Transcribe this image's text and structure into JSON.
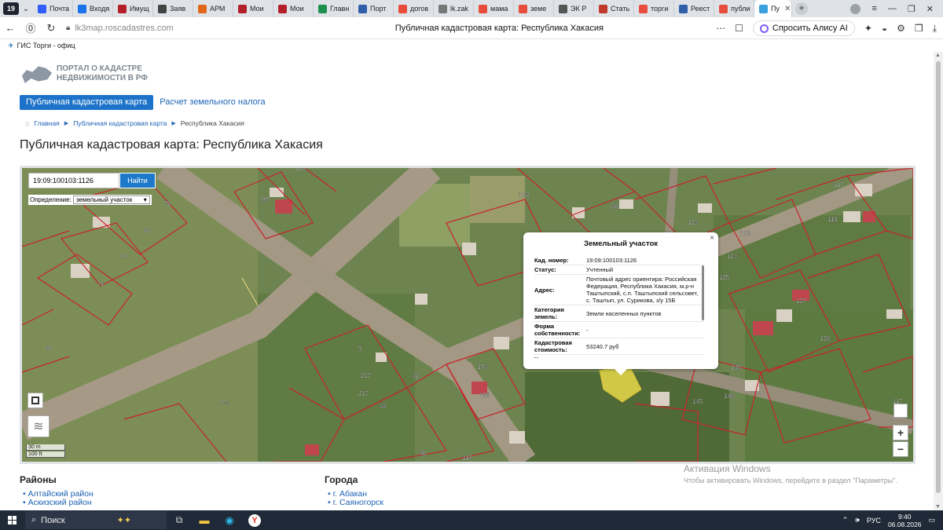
{
  "browser": {
    "tab_counter": "19",
    "tabs": [
      {
        "label": "Почта",
        "color": "#315efb"
      },
      {
        "label": "Входя",
        "color": "#1a73e8"
      },
      {
        "label": "Имущ",
        "color": "#b3202a"
      },
      {
        "label": "Заяв",
        "color": "#444444"
      },
      {
        "label": "АРМ",
        "color": "#e0671a"
      },
      {
        "label": "Мои",
        "color": "#b3202a"
      },
      {
        "label": "Мои",
        "color": "#b3202a"
      },
      {
        "label": "Главн",
        "color": "#1d8f4e"
      },
      {
        "label": "Порт",
        "color": "#2f5fa8"
      },
      {
        "label": "догов",
        "color": "#e74c3c"
      },
      {
        "label": "lk.zak",
        "color": "#777777"
      },
      {
        "label": "мама",
        "color": "#e74c3c"
      },
      {
        "label": "земе",
        "color": "#e74c3c"
      },
      {
        "label": "ЭК Р",
        "color": "#555555"
      },
      {
        "label": "Стать",
        "color": "#c0392b"
      },
      {
        "label": "торги",
        "color": "#e74c3c"
      },
      {
        "label": "Реест",
        "color": "#2f5fa8"
      },
      {
        "label": "публи",
        "color": "#e74c3c"
      },
      {
        "label": "Пу",
        "color": "#3aa0e0",
        "active": true
      }
    ],
    "url": "lk3map.roscadastres.com",
    "page_title": "Публичная кадастровая карта: Республика Хакасия",
    "alice_label": "Спросить Алису AI",
    "bookmark": "ГИС Торги - офиц"
  },
  "site": {
    "logo_text": "ПОРТАЛ О КАДАСТРЕ НЕДВИЖИМОСТИ В РФ",
    "menu": [
      "Публичная кадастровая карта",
      "Расчет земельного налога"
    ],
    "breadcrumb": [
      "Главная",
      "Публичная кадастровая карта",
      "Республика Хакасия"
    ],
    "heading": "Публичная кадастровая карта: Республика Хакасия"
  },
  "map": {
    "search_value": "19:09:100103:1126",
    "search_button": "Найти",
    "definition_label": "Определение:",
    "definition_value": "земельный участок",
    "scale_m": "30 m",
    "scale_ft": "100 ft",
    "zoom_in": "+",
    "zoom_out": "−",
    "parcel_numbers": [
      "75",
      "99",
      "63",
      "70",
      "71",
      "66",
      "774",
      "88",
      "133",
      "117",
      "116",
      "124",
      "123",
      "124",
      "125",
      "127",
      "128",
      "145",
      "148",
      "145",
      "5",
      "217",
      "217",
      "41",
      "44",
      "154",
      "158",
      "123",
      "117",
      "46",
      "110",
      "126"
    ]
  },
  "popup": {
    "title": "Земельный участок",
    "close": "×",
    "rows": [
      {
        "key": "Кад. номер:",
        "value": "19:09:100103:1126"
      },
      {
        "key": "Статус:",
        "value": "Учтенный"
      },
      {
        "key": "Адрес:",
        "value": "Почтовый адрес ориентира: Российская Федерация, Республика Хакасия, м.р-н Таштыпский, с.п. Таштыпский сельсовет, с. Таштып, ул. Сурикова, з/у 15Б"
      },
      {
        "key": "Категория земель:",
        "value": "Земли населенных пунктов"
      },
      {
        "key": "Форма собственности:",
        "value": "-"
      },
      {
        "key": "Кадастровая стоимость:",
        "value": "53240.7 руб"
      },
      {
        "key": "Уточненная",
        "value": ""
      }
    ]
  },
  "watermark": {
    "line1": "Активация Windows",
    "line2": "Чтобы активировать Windows, перейдите в раздел \"Параметры\"."
  },
  "lists": {
    "districts_title": "Районы",
    "districts": [
      "Алтайский район",
      "Аскизский район"
    ],
    "cities_title": "Города",
    "cities": [
      "г. Абакан",
      "г. Саяногорск"
    ]
  },
  "taskbar": {
    "search": "Поиск",
    "lang": "РУС",
    "time": "9:40",
    "date": "06.08.2026"
  }
}
